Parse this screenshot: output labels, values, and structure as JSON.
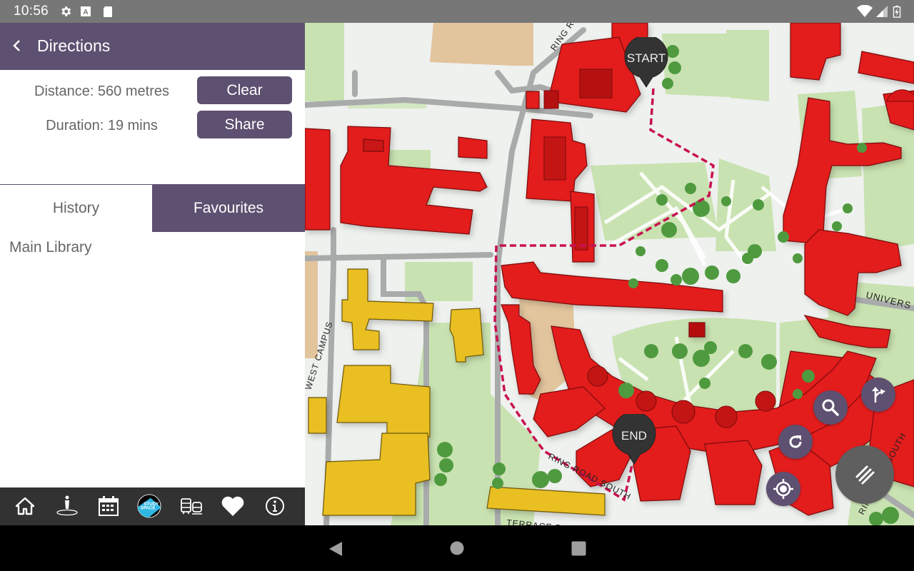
{
  "status_bar": {
    "time": "10:56",
    "left_icons": [
      "settings-icon",
      "a-notification-icon",
      "sd-card-icon"
    ],
    "right_icons": [
      "wifi-icon",
      "signal-icon",
      "battery-charging-icon"
    ]
  },
  "app_bar": {
    "title": "Directions",
    "back_icon": "chevron-left-icon"
  },
  "route_info": {
    "distance": "Distance: 560 metres",
    "duration": "Duration: 19 mins",
    "clear_label": "Clear",
    "share_label": "Share"
  },
  "tabs": [
    {
      "label": "History",
      "active": false
    },
    {
      "label": "Favourites",
      "active": true
    }
  ],
  "list": [
    {
      "label": "Main Library"
    }
  ],
  "bottom_nav": [
    {
      "name": "home",
      "icon": "home-icon"
    },
    {
      "name": "wayfinding",
      "icon": "person-location-icon"
    },
    {
      "name": "events",
      "icon": "calendar-icon"
    },
    {
      "name": "study-space",
      "icon": "study-space-icon",
      "text_line1": "STUDY",
      "text_line2": "SPACE"
    },
    {
      "name": "transport",
      "icon": "bus-train-icon"
    },
    {
      "name": "favourites",
      "icon": "heart-icon"
    },
    {
      "name": "info",
      "icon": "info-icon"
    }
  ],
  "map": {
    "start_label": "START",
    "end_label": "END",
    "street_labels": {
      "ring_road": "RING ROAD",
      "ring_road_south": "RING ROAD SOUTH",
      "ring_road_south_right": "RING ROAD SOUTH",
      "university": "UNIVERS",
      "west_campus": "WEST CAMPUS",
      "terrace_road": "TERRACE ROAD"
    },
    "colors": {
      "building_red": "#e31b1b",
      "building_yellow": "#e9bf21",
      "route": "#c8104f",
      "grass": "#c9e2b1",
      "tree": "#4f9a3f",
      "path": "#a9abab",
      "sand": "#e2c49d"
    },
    "controls": [
      {
        "name": "search",
        "icon": "search-icon"
      },
      {
        "name": "directions",
        "icon": "directions-icon"
      },
      {
        "name": "refresh",
        "icon": "refresh-icon"
      },
      {
        "name": "locate",
        "icon": "my-location-icon"
      },
      {
        "name": "layers",
        "icon": "layers-menu-icon"
      }
    ]
  },
  "system_nav": {
    "back": "back-triangle-icon",
    "home": "home-circle-icon",
    "recents": "recents-square-icon"
  },
  "theme": {
    "primary": "#5e5070",
    "nav_bg": "#323232",
    "text_secondary": "#666666"
  }
}
